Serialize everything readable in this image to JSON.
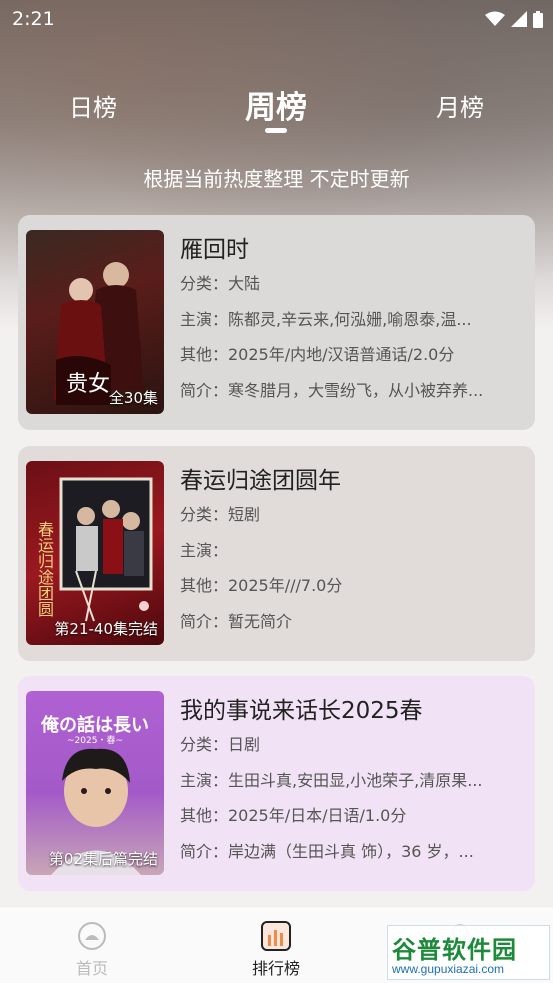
{
  "status": {
    "time": "2:21"
  },
  "tabs": {
    "daily": "日榜",
    "weekly": "周榜",
    "monthly": "月榜",
    "active": "weekly"
  },
  "subtitle": "根据当前热度整理 不定时更新",
  "items": [
    {
      "title": "雁回时",
      "category": "分类：大陆",
      "cast": "主演：陈都灵,辛云来,何泓姗,喻恩泰,温...",
      "other": "其他：2025年/内地/汉语普通话/2.0分",
      "intro": "简介：寒冬腊月，大雪纷飞，从小被弃养...",
      "badge": "全30集",
      "poster_text": "贵女"
    },
    {
      "title": "春运归途团圆年",
      "category": "分类：短剧",
      "cast": "主演：",
      "other": "其他：2025年///7.0分",
      "intro": "简介：暂无简介",
      "badge": "第21-40集完结",
      "poster_text": "春运归途团圆"
    },
    {
      "title": "我的事说来话长2025春",
      "category": "分类：日剧",
      "cast": "主演：生田斗真,安田显,小池荣子,清原果...",
      "other": "其他：2025年/日本/日语/1.0分",
      "intro": "简介：岸边满（生田斗真 饰），36 岁，...",
      "badge": "第02集后篇完结",
      "poster_text": "俺の話は長い",
      "poster_subtext": "~2025・春~"
    }
  ],
  "nav": {
    "home": "首页",
    "ranking": "排行榜",
    "active": "ranking"
  },
  "watermark": {
    "name": "谷普软件园",
    "url": "www.gupuxiazai.com"
  },
  "colors": {
    "accent": "#f08a4b",
    "card1": "#dcdad9",
    "card2": "#e1dcd9",
    "card3": "#f1e3f5"
  }
}
